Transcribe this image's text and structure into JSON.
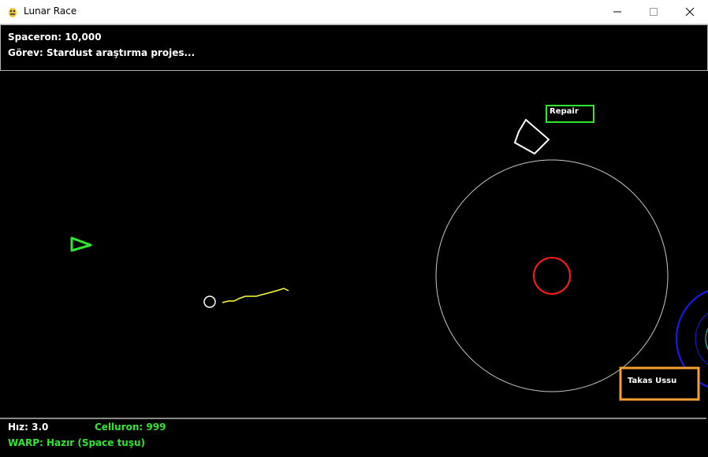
{
  "window": {
    "title": "Lunar Race"
  },
  "hud_top": {
    "spaceron": "Spaceron: 10,000",
    "mission": "Görev: Stardust araştırma projes..."
  },
  "hud_bottom": {
    "speed": "Hız: 3.0",
    "celluron": "Celluron: 999",
    "warp": "WARP: Hazır (Space tuşu)"
  },
  "labels": {
    "repair": "Repair",
    "trade_base": "Takas Ussu"
  },
  "colors": {
    "player": "#2ee82e",
    "trail": "#ffff33",
    "planet": "#ff1a1a",
    "orbit": "#cccccc",
    "repair_box": "#2ee82e",
    "trade_box": "#f5a030",
    "blue_planet": "#1a1aff"
  }
}
